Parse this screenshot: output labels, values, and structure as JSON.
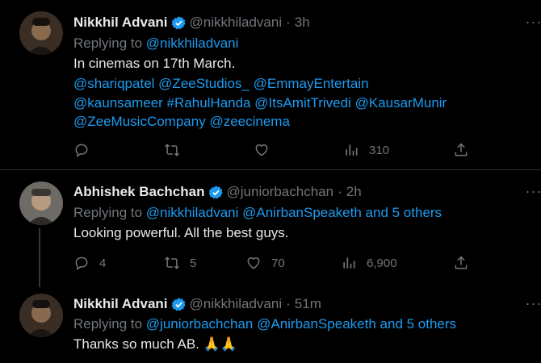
{
  "tweets": [
    {
      "name": "Nikkhil Advani",
      "handle": "@nikkhiladvani",
      "dot": "·",
      "time": "3h",
      "replying_prefix": "Replying to",
      "replying_to": [
        "@nikkhiladvani"
      ],
      "text": "In cinemas on 17th March.",
      "mentions_lines": [
        [
          "@shariqpatel",
          "@ZeeStudios_",
          "@EmmayEntertain"
        ],
        [
          "@kaunsameer",
          "#RahulHanda",
          "@ItsAmitTrivedi",
          "@KausarMunir"
        ],
        [
          "@ZeeMusicCompany",
          "@zeecinema"
        ]
      ],
      "stats": {
        "reply": "",
        "retweet": "",
        "like": "",
        "views": "310"
      }
    },
    {
      "name": "Abhishek Bachchan",
      "handle": "@juniorbachchan",
      "dot": "·",
      "time": "2h",
      "replying_prefix": "Replying to",
      "replying_to": [
        "@nikkhiladvani",
        "@AnirbanSpeaketh",
        "and 5 others"
      ],
      "text": "Looking powerful. All the best guys.",
      "stats": {
        "reply": "4",
        "retweet": "5",
        "like": "70",
        "views": "6,900"
      }
    },
    {
      "name": "Nikkhil Advani",
      "handle": "@nikkhiladvani",
      "dot": "·",
      "time": "51m",
      "replying_prefix": "Replying to",
      "replying_to": [
        "@juniorbachchan",
        "@AnirbanSpeaketh",
        "and 5 others"
      ],
      "text": "Thanks so much AB.",
      "emoji": "🙏🙏"
    }
  ],
  "more_label": "···",
  "colors": {
    "background": "#000000",
    "text": "#e7e9ea",
    "muted": "#71767b",
    "link": "#1d9bf0",
    "verified": "#1d9bf0"
  },
  "icons": [
    "reply-icon",
    "retweet-icon",
    "like-icon",
    "views-icon",
    "share-icon",
    "verified-badge-icon",
    "more-options-icon"
  ]
}
